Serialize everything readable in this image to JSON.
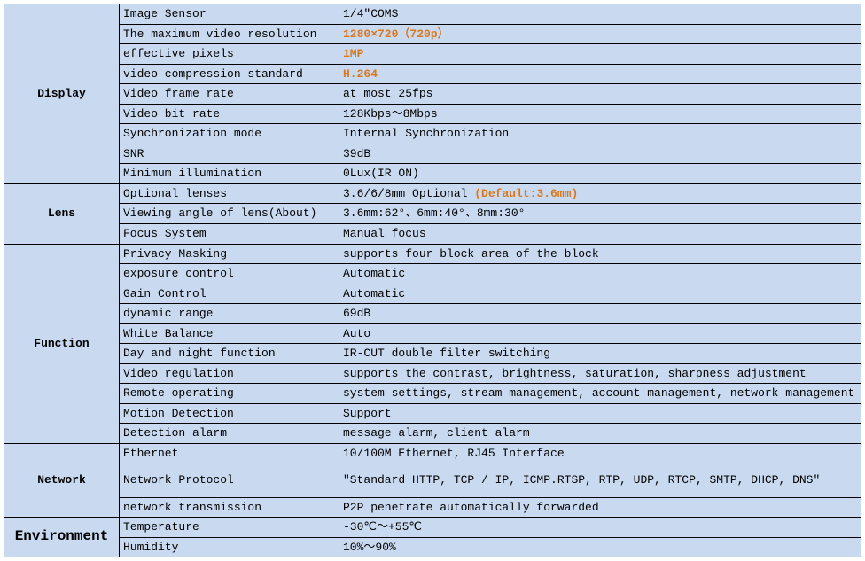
{
  "sections": [
    {
      "category": "Display",
      "rows": [
        {
          "label": "Image Sensor",
          "value": "1/4″COMS"
        },
        {
          "label": "The maximum video resolution",
          "value": "1280×720（720p）",
          "accent": true
        },
        {
          "label": "effective pixels",
          "value": "1MP",
          "accent": true
        },
        {
          "label": "video compression standard",
          "value": "H.264",
          "accent": true
        },
        {
          "label": "Video frame rate",
          "value": "at most 25fps"
        },
        {
          "label": "Video bit rate",
          "value": "128Kbps～8Mbps"
        },
        {
          "label": "Synchronization mode",
          "value": "Internal Synchronization"
        },
        {
          "label": "SNR",
          "value": "39dB"
        },
        {
          "label": "Minimum illumination",
          "value": "0Lux(IR ON)"
        }
      ]
    },
    {
      "category": "Lens",
      "rows": [
        {
          "label": "Optional lenses",
          "value": "3.6/6/8mm Optional ",
          "suffix": "(Default:3.6mm)",
          "suffix_accent": true
        },
        {
          "label": "Viewing angle of lens(About)",
          "value": "3.6mm:62°、6mm:40°、8mm:30°"
        },
        {
          "label": "Focus System",
          "value": "Manual focus"
        }
      ]
    },
    {
      "category": "Function",
      "rows": [
        {
          "label": "Privacy Masking",
          "value": "supports four block area of the block"
        },
        {
          "label": "exposure control",
          "value": "Automatic"
        },
        {
          "label": "Gain Control",
          "value": "Automatic"
        },
        {
          "label": "dynamic range",
          "value": "69dB"
        },
        {
          "label": "White Balance",
          "value": "Auto"
        },
        {
          "label": "Day and night function",
          "value": "IR-CUT double filter switching"
        },
        {
          "label": "Video regulation",
          "value": "supports the contrast, brightness, saturation, sharpness adjustment"
        },
        {
          "label": "Remote operating",
          "value": "system settings, stream management, account management, network management"
        },
        {
          "label": "Motion Detection",
          "value": "Support"
        },
        {
          "label": "Detection alarm",
          "value": "message alarm, client alarm"
        }
      ]
    },
    {
      "category": "Network",
      "rows": [
        {
          "label": "Ethernet",
          "value": " 10/100M Ethernet, RJ45 Interface"
        },
        {
          "label": "Network Protocol",
          "value": "\"Standard HTTP, TCP / IP, ICMP.RTSP, RTP, UDP, RTCP, SMTP, DHCP, DNS\"",
          "tall": true
        },
        {
          "label": "network transmission",
          "value": "P2P penetrate automatically forwarded"
        }
      ]
    },
    {
      "category": "Environment",
      "cat_big": true,
      "rows": [
        {
          "label": "Temperature",
          "value": "-30℃～+55℃"
        },
        {
          "label": "Humidity",
          "value": "10%～90%"
        }
      ]
    }
  ]
}
